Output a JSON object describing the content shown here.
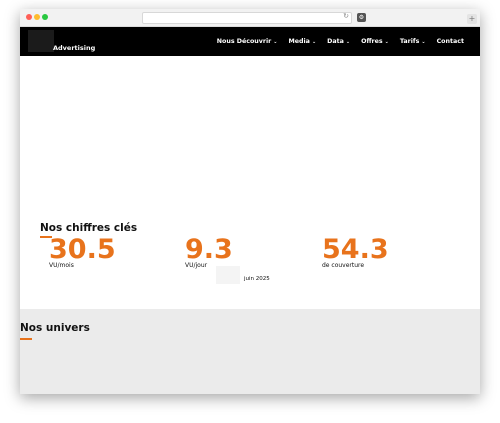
{
  "browser": {
    "reload_icon": "reload-icon",
    "extension_icon": "extension-icon",
    "new_tab_label": "+"
  },
  "site": {
    "brand": "Advertising",
    "nav": [
      {
        "label": "Nous Découvrir",
        "has_dropdown": true
      },
      {
        "label": "Media",
        "has_dropdown": true
      },
      {
        "label": "Data",
        "has_dropdown": true
      },
      {
        "label": "Offres",
        "has_dropdown": true
      },
      {
        "label": "Tarifs",
        "has_dropdown": true
      },
      {
        "label": "Contact",
        "has_dropdown": false
      }
    ],
    "caret": "⌄"
  },
  "stats": {
    "title": "Nos chiffres clés",
    "items": [
      {
        "value": "30.5",
        "label": "VU/mois"
      },
      {
        "value": "9.3",
        "label": "VU/jour"
      },
      {
        "value": "54.3",
        "label": "de couverture"
      }
    ],
    "date": "juin 2025"
  },
  "univers": {
    "title": "Nos univers"
  },
  "colors": {
    "accent": "#e8731c",
    "navbar": "#000000",
    "univers_bg": "#ebebeb"
  }
}
